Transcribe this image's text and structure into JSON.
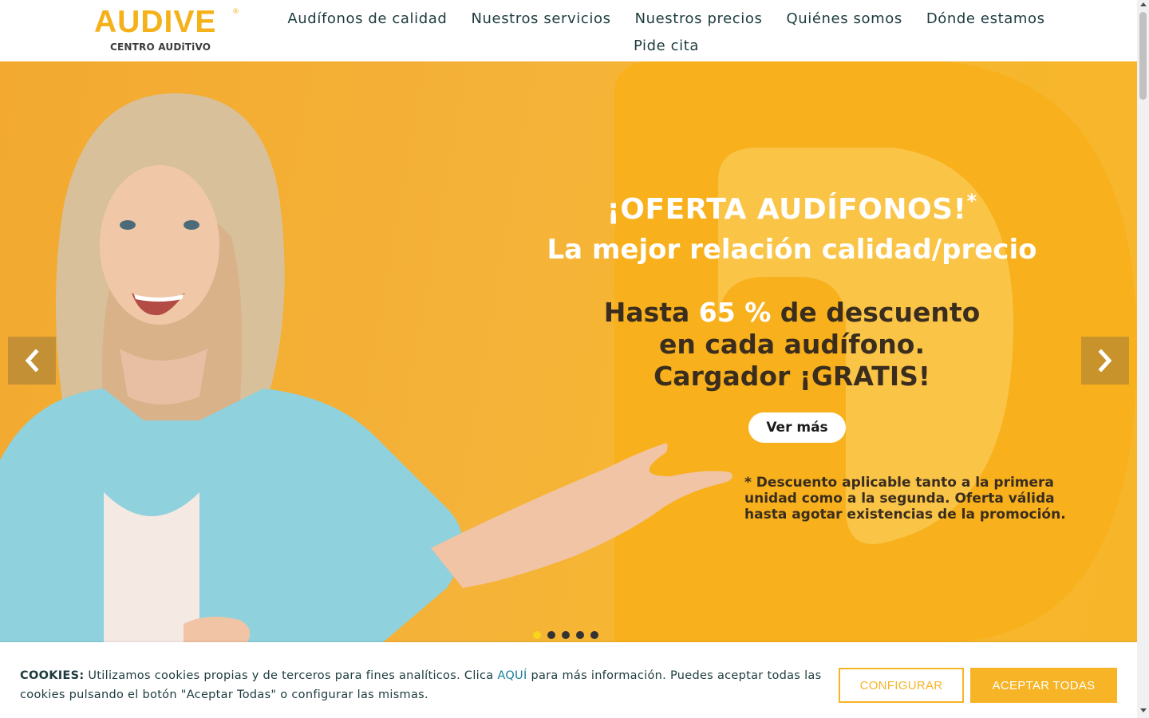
{
  "brand": {
    "logo_text": "AUDIVE",
    "logo_reg": "®",
    "logo_subtitle": "CENTRO AUDiTiVO",
    "accent_color": "#f5b11a"
  },
  "nav": {
    "items": [
      {
        "label": "Audífonos de calidad"
      },
      {
        "label": "Nuestros servicios"
      },
      {
        "label": "Nuestros precios"
      },
      {
        "label": "Quiénes somos"
      },
      {
        "label": "Dónde estamos"
      },
      {
        "label": "Pide cita"
      }
    ]
  },
  "hero": {
    "offer_title": "¡OFERTA AUDÍFONOS!",
    "offer_asterisk": "*",
    "subtitle": "La mejor relación calidad/precio",
    "discount_line1_pre": "Hasta ",
    "discount_pct": "65 %",
    "discount_line1_post": " de descuento",
    "discount_line2": "en cada audífono.",
    "discount_line3": "Cargador ¡GRATIS!",
    "cta_label": "Ver más",
    "footnote": "* Descuento aplicable tanto a la primera unidad como a la segunda. Oferta válida hasta agotar existencias de la promoción.",
    "prev_icon": "chevron-left-icon",
    "next_icon": "chevron-right-icon",
    "slides_count": 5,
    "active_slide": 1
  },
  "cookies": {
    "label": "COOKIES:",
    "text_before_link": " Utilizamos cookies propias y de terceros para fines analíticos. Clica ",
    "link_text": "AQUÍ",
    "text_after_link": " para más información. Puedes aceptar todas las cookies pulsando el botón \"Aceptar Todas\" o configurar las mismas.",
    "configure_label": "CONFIGURAR",
    "accept_label": "ACEPTAR TODAS"
  }
}
